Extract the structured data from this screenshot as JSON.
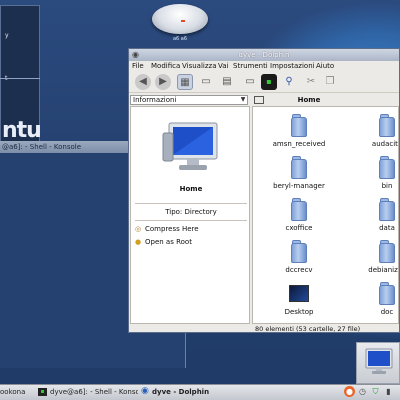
{
  "desktop": {
    "ubuntu_window": {
      "logo_text": "ntu",
      "line1": "y",
      "line2": "t"
    },
    "konsole_window": {
      "title": "@a6]: - Shell - Konsole"
    },
    "device": {
      "label": "a6    a6"
    }
  },
  "dolphin": {
    "title": "dyve - Dolphin",
    "menu": [
      "File",
      "Modifica",
      "Visualizza",
      "Vai",
      "Strumenti",
      "Impostazioni",
      "Aiuto"
    ],
    "toolbar_icons": [
      "back-icon",
      "forward-icon",
      "view-icons-icon",
      "view-details-icon",
      "view-columns-icon",
      "preview-icon",
      "split-icon",
      "terminal-icon",
      "search-icon",
      "cut-icon",
      "copy-icon"
    ],
    "panel": {
      "selector": "Informazioni",
      "name": "Home",
      "type_label": "Tipo: Directory",
      "actions": [
        {
          "label": "Compress Here",
          "icon": "compress-icon"
        },
        {
          "label": "Open as Root",
          "icon": "root-icon"
        }
      ]
    },
    "location": "Home",
    "items": [
      {
        "name": "amsn_received",
        "type": "folder"
      },
      {
        "name": "audacity",
        "type": "folder"
      },
      {
        "name": "beryl-manager",
        "type": "folder"
      },
      {
        "name": "bin",
        "type": "folder"
      },
      {
        "name": "cxoffice",
        "type": "folder"
      },
      {
        "name": "data",
        "type": "folder"
      },
      {
        "name": "dccrecv",
        "type": "folder"
      },
      {
        "name": "debianizza",
        "type": "folder"
      },
      {
        "name": "Desktop",
        "type": "desktop"
      },
      {
        "name": "doc",
        "type": "folder"
      }
    ],
    "status": "80 elementi (53 cartelle, 27 file)"
  },
  "taskbar": {
    "tasks": [
      {
        "label": "ookona",
        "icon": "konsole-icon"
      },
      {
        "label": "dyve@a6]: - Shell - Konso",
        "icon": "konsole-icon"
      },
      {
        "label": "dyve - Dolphin",
        "icon": "dolphin-icon",
        "active": true
      }
    ],
    "tray": [
      "fox-icon",
      "clock-icon",
      "shield-icon",
      "network-icon"
    ]
  }
}
